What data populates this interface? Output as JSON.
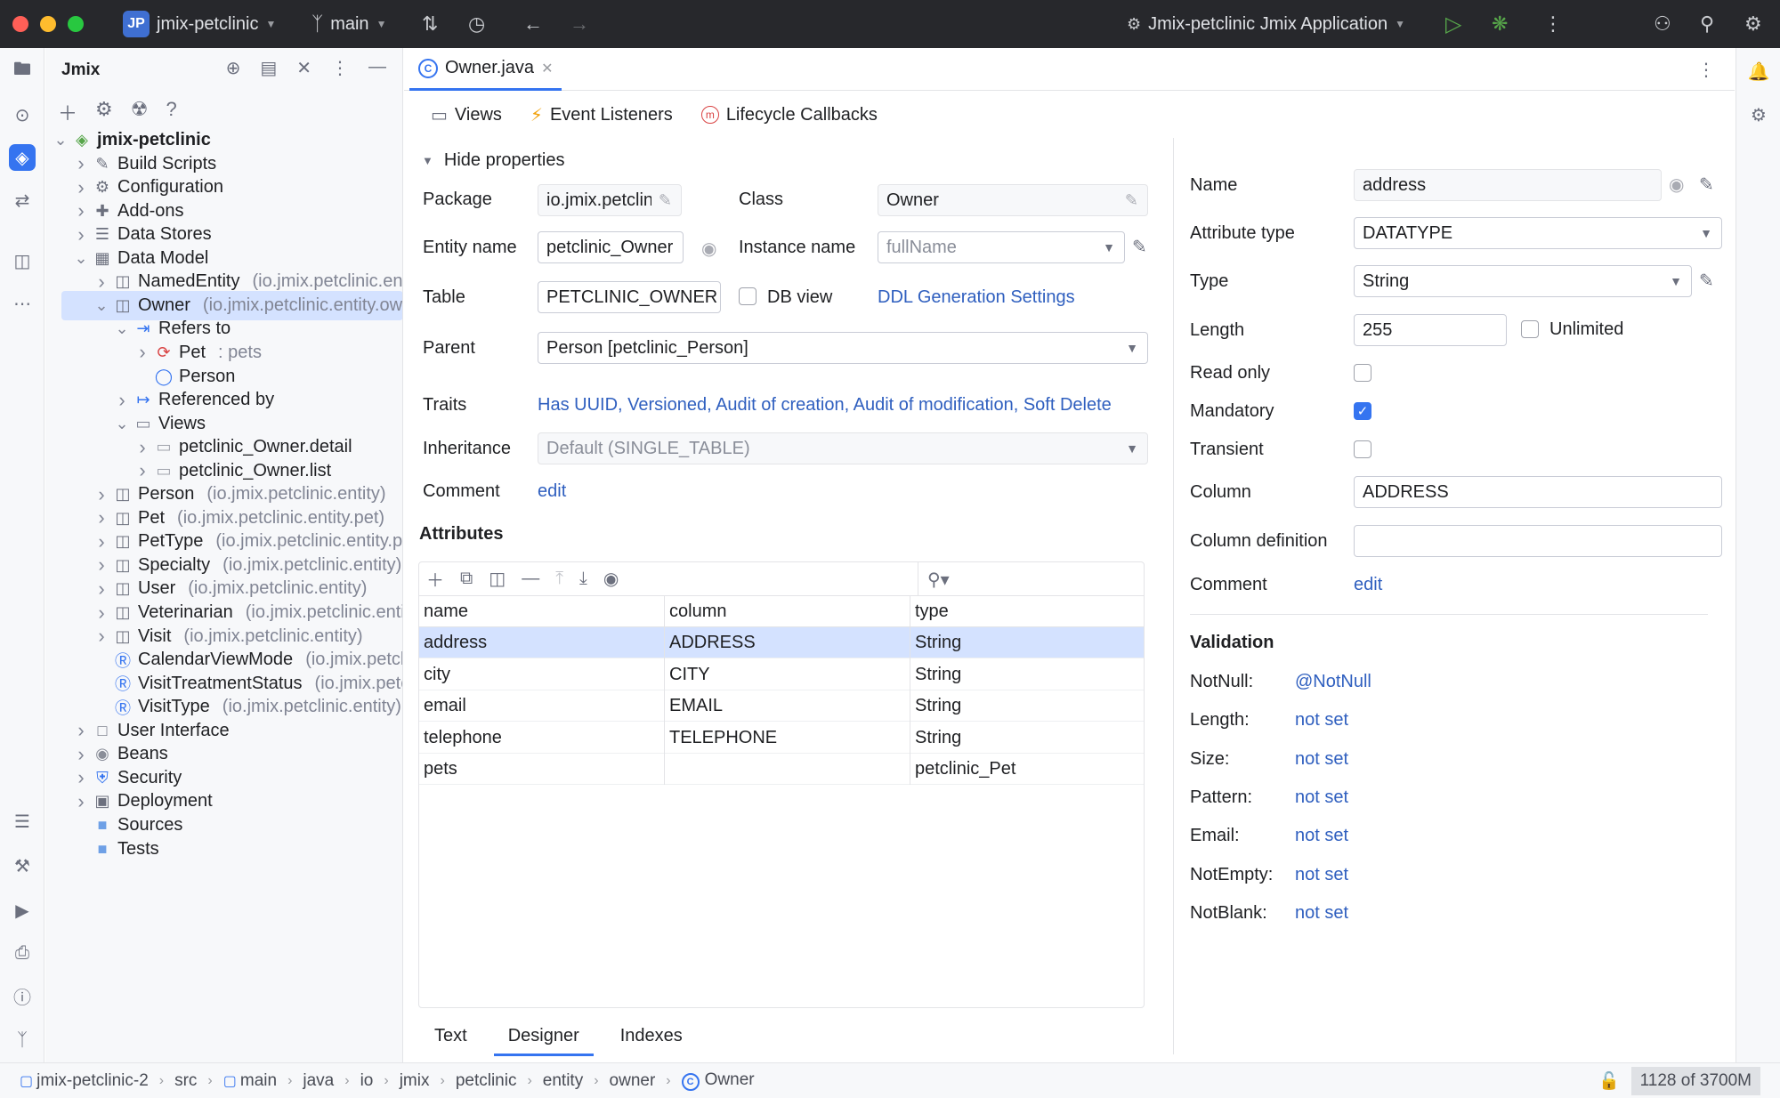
{
  "titlebar": {
    "project_badge": "JP",
    "project_name": "jmix-petclinic",
    "branch": "main",
    "run_config": "Jmix-petclinic Jmix Application"
  },
  "project_panel": {
    "title": "Jmix",
    "tree": [
      {
        "label": "jmix-petclinic",
        "hint": "",
        "depth": 0,
        "arrow": "down",
        "icon": "jmix-icon",
        "bold": true
      },
      {
        "label": "Build Scripts",
        "hint": "",
        "depth": 1,
        "arrow": "right",
        "icon": "scripts-icon"
      },
      {
        "label": "Configuration",
        "hint": "",
        "depth": 1,
        "arrow": "right",
        "icon": "config-icon"
      },
      {
        "label": "Add-ons",
        "hint": "",
        "depth": 1,
        "arrow": "right",
        "icon": "addons-icon"
      },
      {
        "label": "Data Stores",
        "hint": "",
        "depth": 1,
        "arrow": "right",
        "icon": "datastores-icon"
      },
      {
        "label": "Data Model",
        "hint": "",
        "depth": 1,
        "arrow": "down",
        "icon": "datamodel-icon"
      },
      {
        "label": "NamedEntity",
        "hint": "(io.jmix.petclinic.entity)",
        "depth": 2,
        "arrow": "right",
        "icon": "entity-icon"
      },
      {
        "label": "Owner",
        "hint": "(io.jmix.petclinic.entity.owner)",
        "depth": 2,
        "arrow": "down",
        "icon": "entity-icon",
        "selected": true
      },
      {
        "label": "Refers to",
        "hint": "",
        "depth": 3,
        "arrow": "down",
        "icon": "refers-to-icon"
      },
      {
        "label": "Pet",
        "hint": ": pets",
        "depth": 4,
        "arrow": "right",
        "icon": "pet-relation-icon"
      },
      {
        "label": "Person",
        "hint": "",
        "depth": 4,
        "arrow": "",
        "icon": "person-icon"
      },
      {
        "label": "Referenced by",
        "hint": "",
        "depth": 3,
        "arrow": "right",
        "icon": "referenced-by-icon"
      },
      {
        "label": "Views",
        "hint": "",
        "depth": 3,
        "arrow": "down",
        "icon": "views-icon"
      },
      {
        "label": "petclinic_Owner.detail",
        "hint": "",
        "depth": 4,
        "arrow": "right",
        "icon": "view-icon"
      },
      {
        "label": "petclinic_Owner.list",
        "hint": "",
        "depth": 4,
        "arrow": "right",
        "icon": "view-icon"
      },
      {
        "label": "Person",
        "hint": "(io.jmix.petclinic.entity)",
        "depth": 2,
        "arrow": "right",
        "icon": "entity-icon"
      },
      {
        "label": "Pet",
        "hint": "(io.jmix.petclinic.entity.pet)",
        "depth": 2,
        "arrow": "right",
        "icon": "entity-icon"
      },
      {
        "label": "PetType",
        "hint": "(io.jmix.petclinic.entity.pet)",
        "depth": 2,
        "arrow": "right",
        "icon": "entity-icon"
      },
      {
        "label": "Specialty",
        "hint": "(io.jmix.petclinic.entity)",
        "depth": 2,
        "arrow": "right",
        "icon": "entity-icon"
      },
      {
        "label": "User",
        "hint": "(io.jmix.petclinic.entity)",
        "depth": 2,
        "arrow": "right",
        "icon": "entity-icon"
      },
      {
        "label": "Veterinarian",
        "hint": "(io.jmix.petclinic.entity)",
        "depth": 2,
        "arrow": "right",
        "icon": "entity-icon"
      },
      {
        "label": "Visit",
        "hint": "(io.jmix.petclinic.entity)",
        "depth": 2,
        "arrow": "right",
        "icon": "entity-icon"
      },
      {
        "label": "CalendarViewMode",
        "hint": "(io.jmix.petclinic)",
        "depth": 2,
        "arrow": "",
        "icon": "enum-icon"
      },
      {
        "label": "VisitTreatmentStatus",
        "hint": "(io.jmix.petclinic)",
        "depth": 2,
        "arrow": "",
        "icon": "enum-icon"
      },
      {
        "label": "VisitType",
        "hint": "(io.jmix.petclinic.entity)",
        "depth": 2,
        "arrow": "",
        "icon": "enum-icon"
      },
      {
        "label": "User Interface",
        "hint": "",
        "depth": 1,
        "arrow": "right",
        "icon": "ui-icon"
      },
      {
        "label": "Beans",
        "hint": "",
        "depth": 1,
        "arrow": "right",
        "icon": "beans-icon"
      },
      {
        "label": "Security",
        "hint": "",
        "depth": 1,
        "arrow": "right",
        "icon": "security-icon"
      },
      {
        "label": "Deployment",
        "hint": "",
        "depth": 1,
        "arrow": "right",
        "icon": "deployment-icon"
      },
      {
        "label": "Sources",
        "hint": "",
        "depth": 1,
        "arrow": "",
        "icon": "folder-icon"
      },
      {
        "label": "Tests",
        "hint": "",
        "depth": 1,
        "arrow": "",
        "icon": "folder-icon"
      }
    ]
  },
  "editor": {
    "tab_label": "Owner.java",
    "toolbar": {
      "views": "Views",
      "event_listeners": "Event Listeners",
      "lifecycle_callbacks": "Lifecycle Callbacks"
    },
    "hide_properties": "Hide properties",
    "form": {
      "package_label": "Package",
      "package_value": "io.jmix.petclinic.entity.owner",
      "class_label": "Class",
      "class_value": "Owner",
      "entity_name_label": "Entity name",
      "entity_name_value": "petclinic_Owner",
      "instance_name_label": "Instance name",
      "instance_name_value": "fullName",
      "table_label": "Table",
      "table_value": "PETCLINIC_OWNER",
      "db_view_label": "DB view",
      "ddl_link": "DDL Generation Settings",
      "parent_label": "Parent",
      "parent_value": "Person [petclinic_Person]",
      "traits_label": "Traits",
      "traits_value": "Has UUID, Versioned, Audit of creation, Audit of modification, Soft Delete",
      "inheritance_label": "Inheritance",
      "inheritance_value": "Default (SINGLE_TABLE)",
      "comment_label": "Comment",
      "comment_link": "edit"
    },
    "attributes": {
      "title": "Attributes",
      "columns": [
        "name",
        "column",
        "type"
      ],
      "rows": [
        {
          "name": "address",
          "column": "ADDRESS",
          "type": "String"
        },
        {
          "name": "city",
          "column": "CITY",
          "type": "String"
        },
        {
          "name": "email",
          "column": "EMAIL",
          "type": "String"
        },
        {
          "name": "telephone",
          "column": "TELEPHONE",
          "type": "String"
        },
        {
          "name": "pets",
          "column": "",
          "type": "petclinic_Pet"
        }
      ]
    },
    "bottom_tabs": [
      "Text",
      "Designer",
      "Indexes"
    ]
  },
  "properties": {
    "name_label": "Name",
    "name_value": "address",
    "attr_type_label": "Attribute type",
    "attr_type_value": "DATATYPE",
    "type_label": "Type",
    "type_value": "String",
    "length_label": "Length",
    "length_value": "255",
    "unlimited_label": "Unlimited",
    "read_only_label": "Read only",
    "mandatory_label": "Mandatory",
    "transient_label": "Transient",
    "column_label": "Column",
    "column_value": "ADDRESS",
    "column_def_label": "Column definition",
    "column_def_value": "",
    "comment_label": "Comment",
    "comment_link": "edit",
    "validation_title": "Validation",
    "validation": [
      {
        "label": "NotNull:",
        "value": "@NotNull"
      },
      {
        "label": "Length:",
        "value": "not set"
      },
      {
        "label": "Size:",
        "value": "not set"
      },
      {
        "label": "Pattern:",
        "value": "not set"
      },
      {
        "label": "Email:",
        "value": "not set"
      },
      {
        "label": "NotEmpty:",
        "value": "not set"
      },
      {
        "label": "NotBlank:",
        "value": "not set"
      }
    ]
  },
  "statusbar": {
    "crumbs": [
      "jmix-petclinic-2",
      "src",
      "main",
      "java",
      "io",
      "jmix",
      "petclinic",
      "entity",
      "owner",
      "Owner"
    ],
    "memory": "1128 of 3700M"
  },
  "colors": {
    "accent": "#3574f0",
    "link": "#2f5fbf",
    "selection": "#d4e2ff",
    "titlebar": "#27282c"
  }
}
